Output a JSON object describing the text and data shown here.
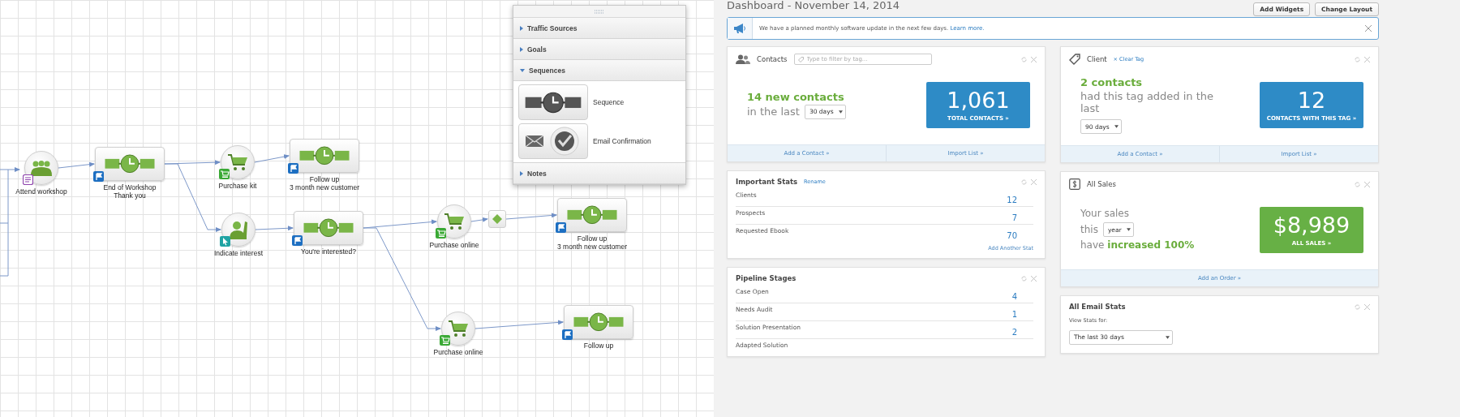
{
  "workflow": {
    "nodes": [
      {
        "kind": "people",
        "label": "Attend workshop"
      },
      {
        "kind": "sequence",
        "label": "End of Workshop\nThank you"
      },
      {
        "kind": "cart",
        "label": "Purchase kit"
      },
      {
        "kind": "sequence",
        "label": "Follow up\n3 month new customer"
      },
      {
        "kind": "person",
        "label": "Indicate interest"
      },
      {
        "kind": "sequence",
        "label": "You're interested?"
      },
      {
        "kind": "cart",
        "label": "Purchase online"
      },
      {
        "kind": "diamond"
      },
      {
        "kind": "sequence",
        "label": "Follow up\n3 month new customer"
      },
      {
        "kind": "cart",
        "label": "Purchase online"
      },
      {
        "kind": "sequence",
        "label": "Follow up"
      }
    ]
  },
  "palette": {
    "sections": [
      {
        "title": "Traffic Sources",
        "expanded": false
      },
      {
        "title": "Goals",
        "expanded": false
      },
      {
        "title": "Sequences",
        "expanded": true,
        "items": [
          {
            "kind": "sequence",
            "label": "Sequence"
          },
          {
            "kind": "email",
            "label": "Email Confirmation"
          }
        ]
      },
      {
        "title": "Notes",
        "expanded": false
      }
    ]
  },
  "dashboard": {
    "title": "Dashboard - November 14, 2014",
    "buttons": [
      "Add Widgets",
      "Change Layout"
    ],
    "notice": {
      "text": "We have a planned monthly software update in the next few days.",
      "link": "Learn more."
    },
    "columns": [
      [
        {
          "kind": "contacts",
          "title": "Contacts",
          "filter_placeholder": "Type to filter by tag...",
          "headline": "14 new contacts",
          "subline": "in the last",
          "period": "30 days",
          "big_number": "1,061",
          "big_label": "TOTAL CONTACTS »",
          "footer_links": [
            "Add a Contact »",
            "Import List »"
          ]
        },
        {
          "kind": "stats",
          "title": "Important Stats",
          "title_link": "Rename",
          "rows": [
            {
              "label": "Clients",
              "value": "12"
            },
            {
              "label": "Prospects",
              "value": "7"
            },
            {
              "label": "Requested Ebook",
              "value": "70"
            }
          ],
          "add_link": "Add Another Stat"
        },
        {
          "kind": "stats",
          "title": "Pipeline Stages",
          "rows": [
            {
              "label": "Case Open",
              "value": "4"
            },
            {
              "label": "Needs Audit",
              "value": "1"
            },
            {
              "label": "Solution Presentation",
              "value": "2"
            },
            {
              "label": "Adapted Solution"
            }
          ]
        }
      ],
      [
        {
          "kind": "tag",
          "title": "Client",
          "title_link": "× Clear Tag",
          "headline": "2 contacts",
          "subline": "had this tag added in the last",
          "period": "90 days",
          "big_number": "12",
          "big_label": "CONTACTS WITH THIS TAG »",
          "footer_links": [
            "Add a Contact »",
            "Import List »"
          ]
        },
        {
          "kind": "sales",
          "title": "All Sales",
          "lines": [
            "Your sales",
            "this",
            "have **increased 100%**"
          ],
          "period": "year",
          "big_number": "$8,989",
          "big_label": "ALL SALES »",
          "footer_links": [
            "Add an Order »"
          ]
        },
        {
          "kind": "email",
          "title": "All Email Stats",
          "field_label": "View Stats for:",
          "select": "The last 30 days"
        }
      ]
    ]
  }
}
